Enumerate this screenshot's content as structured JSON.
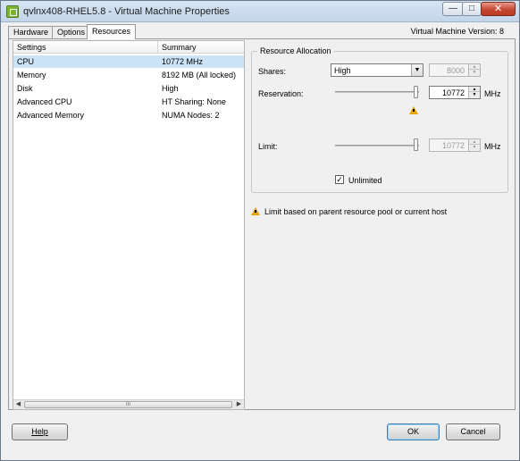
{
  "window": {
    "title": "qvlnx408-RHEL5.8 - Virtual Machine Properties",
    "minimize": "—",
    "maximize": "□",
    "close": "✕"
  },
  "tabs": [
    {
      "label": "Hardware"
    },
    {
      "label": "Options"
    },
    {
      "label": "Resources",
      "selected": true
    }
  ],
  "vm_version": "Virtual Machine Version: 8",
  "settings_list": {
    "columns": [
      "Settings",
      "Summary"
    ],
    "rows": [
      {
        "setting": "CPU",
        "summary": "10772 MHz",
        "selected": true
      },
      {
        "setting": "Memory",
        "summary": "8192 MB (All locked)"
      },
      {
        "setting": "Disk",
        "summary": "High"
      },
      {
        "setting": "Advanced CPU",
        "summary": "HT Sharing: None"
      },
      {
        "setting": "Advanced Memory",
        "summary": "NUMA Nodes: 2"
      }
    ],
    "scroll_grip": "III"
  },
  "resource_allocation": {
    "title": "Resource Allocation",
    "shares": {
      "label": "Shares:",
      "selected": "High",
      "value": "8000"
    },
    "reservation": {
      "label": "Reservation:",
      "value": "10772",
      "unit": "MHz",
      "slider_fraction": 1.0
    },
    "limit": {
      "label": "Limit:",
      "value": "10772",
      "unit": "MHz",
      "slider_fraction": 1.0
    },
    "unlimited": {
      "label": "Unlimited",
      "checked": true,
      "mark": "✓"
    }
  },
  "warning_note": "Limit based on parent resource pool or current host",
  "buttons": {
    "help": "Help",
    "ok": "OK",
    "cancel": "Cancel"
  },
  "colors": {
    "selection": "#cce4f7",
    "warning": "#e4a500"
  }
}
